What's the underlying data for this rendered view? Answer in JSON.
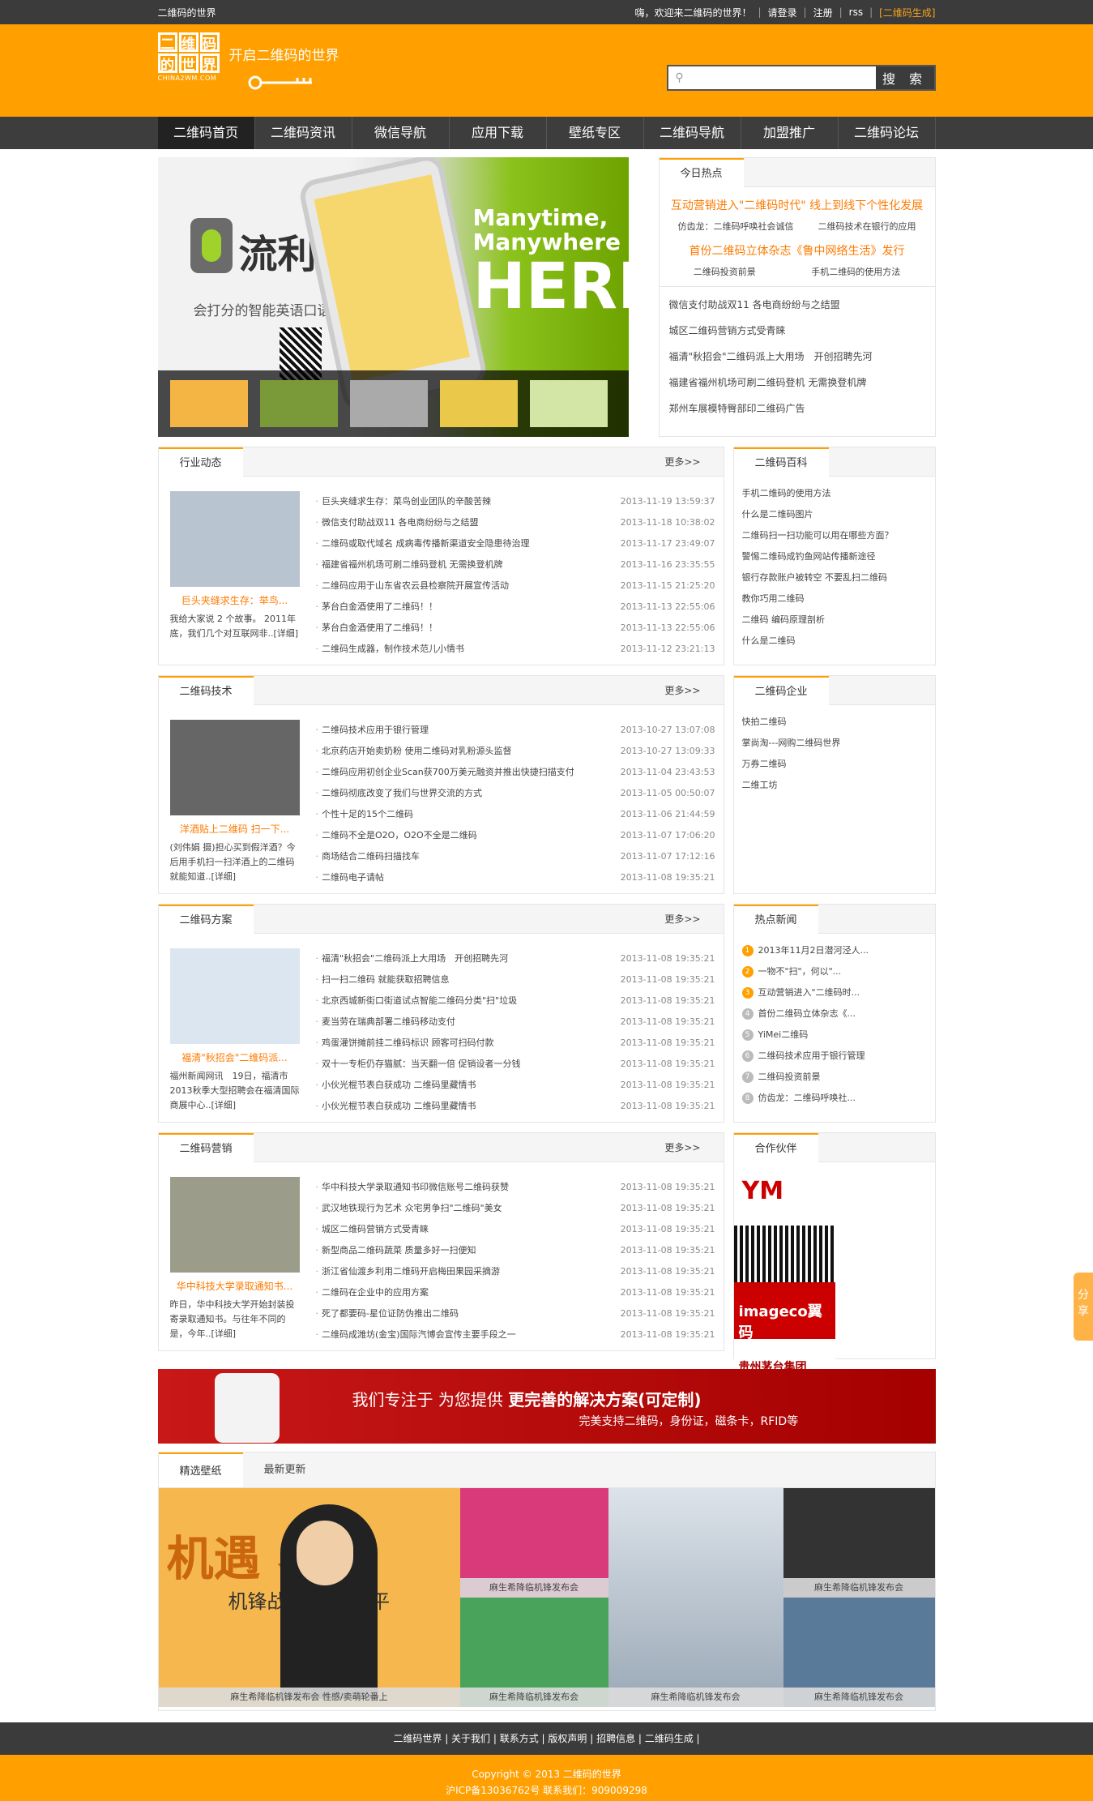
{
  "topbar": {
    "site": "二维码的世界",
    "welcome": "嗨，欢迎来二维码的世界！",
    "login": "请登录",
    "register": "注册",
    "rss": "rss",
    "generate": "[二维码生成]"
  },
  "header": {
    "slogan": "开启二维码的世界",
    "brand": "CHINA2WM.COM",
    "logo_chars": [
      "二",
      "维",
      "码",
      "的",
      "世",
      "界"
    ],
    "search_placeholder": "",
    "search_button": "搜 索"
  },
  "nav": [
    "二维码首页",
    "二维码资讯",
    "微信导航",
    "应用下载",
    "壁纸专区",
    "二维码导航",
    "加盟推广",
    "二维码论坛"
  ],
  "banner": {
    "name": "流利说",
    "sub": "会打分的智能英语口语私教",
    "right_line1": "Manytime,",
    "right_line2": "Manywhere",
    "right_big": "HERE"
  },
  "hot": {
    "title": "今日热点",
    "headline1": "互动营销进入\"二维码时代\" 线上到线下个性化发展",
    "pair1": [
      "仿齿龙：二维码呼唤社会诚信",
      "二维码技术在银行的应用"
    ],
    "headline2": "首份二维码立体杂志《鲁中网络生活》发行",
    "pair2": [
      "二维码投资前景",
      "手机二维码的使用方法"
    ],
    "items": [
      "微信支付助战双11 各电商纷纷与之结盟",
      "城区二维码营销方式受青睐",
      "福清\"秋招会\"二维码派上大用场　开创招聘先河",
      "福建省福州机场可刷二维码登机 无需换登机牌",
      "郑州车展模特臀部印二维码广告"
    ]
  },
  "sections": [
    {
      "title": "行业动态",
      "more": "更多>>",
      "caption": "巨头夹缝求生存：举鸟...",
      "desc": "我给大家说 2 个故事。 2011年底，我们几个对互联网非..[详细]",
      "items": [
        [
          "巨头夹缝求生存：菜鸟创业团队的辛酸苦辣",
          "2013-11-19 13:59:37"
        ],
        [
          "微信支付助战双11 各电商纷纷与之结盟",
          "2013-11-18 10:38:02"
        ],
        [
          "二维码或取代域名 成病毒传播新渠道安全隐患待治理",
          "2013-11-17 23:49:07"
        ],
        [
          "福建省福州机场可刷二维码登机 无需换登机牌",
          "2013-11-16 23:35:55"
        ],
        [
          "二维码应用于山东省农云县检察院开展宣传活动",
          "2013-11-15 21:25:20"
        ],
        [
          "茅台白金酒使用了二维码！！",
          "2013-11-13 22:55:06"
        ],
        [
          "茅台白金酒使用了二维码！！",
          "2013-11-13 22:55:06"
        ],
        [
          "二维码生成器，制作技术范儿小情书",
          "2013-11-12 23:21:13"
        ]
      ]
    },
    {
      "title": "二维码技术",
      "more": "更多>>",
      "caption": "洋酒贴上二维码 扫一下...",
      "desc": "(刘伟娟 摄)担心买到假洋酒？今后用手机扫一扫洋酒上的二维码就能知道..[详细]",
      "items": [
        [
          "二维码技术应用于银行管理",
          "2013-10-27 13:07:08"
        ],
        [
          "北京药店开始卖奶粉 使用二维码对乳粉源头监督",
          "2013-10-27 13:09:33"
        ],
        [
          "二维码应用初创企业Scan获700万美元融资并推出快捷扫描支付",
          "2013-11-04 23:43:53"
        ],
        [
          "二维码彻底改变了我们与世界交流的方式",
          "2013-11-05 00:50:07"
        ],
        [
          "个性十足的15个二维码",
          "2013-11-06 21:44:59"
        ],
        [
          "二维码不全是O2O，O2O不全是二维码",
          "2013-11-07 17:06:20"
        ],
        [
          "商场结合二维码扫描找车",
          "2013-11-07 17:12:16"
        ],
        [
          "二维码电子请帖",
          "2013-11-08 19:35:21"
        ]
      ]
    },
    {
      "title": "二维码方案",
      "more": "更多>>",
      "caption": "福清\"秋招会\"二维码派...",
      "desc": "福州新闻网讯　19日，福清市2013秋季大型招聘会在福清国际商展中心..[详细]",
      "items": [
        [
          "福清\"秋招会\"二维码派上大用场　开创招聘先河",
          "2013-11-08 19:35:21"
        ],
        [
          "扫一扫二维码 就能获取招聘信息",
          "2013-11-08 19:35:21"
        ],
        [
          "北京西城新街口街道试点智能二维码分类\"扫\"垃圾",
          "2013-11-08 19:35:21"
        ],
        [
          "麦当劳在瑞典部署二维码移动支付",
          "2013-11-08 19:35:21"
        ],
        [
          "鸡蛋灌饼摊前挂二维码标识 顾客可扫码付款",
          "2013-11-08 19:35:21"
        ],
        [
          "双十一专柜仍存猫腻：当天翻一倍 促销设者一分钱",
          "2013-11-08 19:35:21"
        ],
        [
          "小伙光棍节表白获成功 二维码里藏情书",
          "2013-11-08 19:35:21"
        ],
        [
          "小伙光棍节表白获成功 二维码里藏情书",
          "2013-11-08 19:35:21"
        ]
      ]
    },
    {
      "title": "二维码营销",
      "more": "更多>>",
      "caption": "华中科技大学录取通知书...",
      "desc": "昨日，华中科技大学开始封装投寄录取通知书。与往年不同的是，今年..[详细]",
      "items": [
        [
          "华中科技大学录取通知书印微信账号二维码获赞",
          "2013-11-08 19:35:21"
        ],
        [
          "武汉地铁现行为艺术 众宅男争扫\"二维码\"美女",
          "2013-11-08 19:35:21"
        ],
        [
          "城区二维码营销方式受青睐",
          "2013-11-08 19:35:21"
        ],
        [
          "新型商品二维码蔬菜 质量多好一扫便知",
          "2013-11-08 19:35:21"
        ],
        [
          "浙江省仙渡乡利用二维码开启梅田果园采摘游",
          "2013-11-08 19:35:21"
        ],
        [
          "二维码在企业中的应用方案",
          "2013-11-08 19:35:21"
        ],
        [
          "死了都要码-星位证防伪推出二维码",
          "2013-11-08 19:35:21"
        ],
        [
          "二维码成潍坊(金宝)国际汽博会宣传主要手段之一",
          "2013-11-08 19:35:21"
        ]
      ]
    }
  ],
  "side": {
    "baike": {
      "title": "二维码百科",
      "items": [
        "手机二维码的使用方法",
        "什么是二维码图片",
        "二维码扫一扫功能可以用在哪些方面？",
        "警惕二维码成钓鱼网站传播新途径",
        "银行存款账户被转空 不要乱扫二维码",
        "教你巧用二维码",
        "二维码 编码原理剖析",
        "什么是二维码"
      ]
    },
    "company": {
      "title": "二维码企业",
      "items": [
        "快拍二维码",
        "掌尚淘---网购二维码世界",
        "万券二维码",
        "二维工坊"
      ]
    },
    "hotnews": {
      "title": "热点新闻",
      "items": [
        "2013年11月2日潜河泾人...",
        "一物不\"扫\"，何以\"...",
        "互动营销进入\"二维码时...",
        "首份二维码立体杂志《...",
        "YiMei二维码",
        "二维码技术应用于银行管理",
        "二维码投资前景",
        "仿齿龙：二维码呼唤社..."
      ]
    },
    "partner": {
      "title": "合作伙伴",
      "logos": [
        "YM",
        "QR",
        "imageco翼码",
        "贵州茅台集团"
      ]
    }
  },
  "adbar": {
    "line1_a": "我们专注于 为您提供 ",
    "line1_b": "更完善的解决方案(可定制)",
    "line2": "完美支持二维码，身份证，磁条卡，RFID等"
  },
  "wallpaper": {
    "tab_active": "精选壁纸",
    "tab_other": "最新更新",
    "big_text": "机遇 界",
    "big_text2": "机锋战略    暨游戏平",
    "big_caption": "麻生希降临机锋发布会 性感/卖萌轮番上",
    "captions": [
      "麻生希降临机锋发布会",
      "麻生希降临机锋发布会",
      "麻生希降临机锋发布会",
      "麻生希降临机锋发布会",
      "麻生希降临机锋发布会"
    ]
  },
  "footer": {
    "links": "二维码世界 | 关于我们 | 联系方式 | 版权声明 | 招聘信息 | 二维码生成 |",
    "copyright": "Copyright © 2013 二维码的世界",
    "icp": "沪ICP备13036762号  联系我们：909009298"
  },
  "share": "分享"
}
